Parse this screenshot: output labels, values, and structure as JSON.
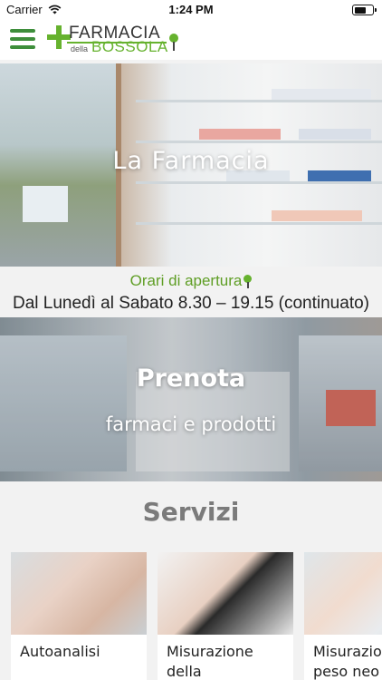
{
  "status_bar": {
    "carrier": "Carrier",
    "time": "1:24 PM",
    "battery_level": 0.7
  },
  "header": {
    "logo": {
      "line1": "FARMACIA",
      "della": "della",
      "line2": "BOSSOLA"
    },
    "menu_icon": "hamburger-menu-icon"
  },
  "hero": {
    "title": "La Farmacia",
    "slides_count": 2,
    "active_slide": 1
  },
  "hours": {
    "title": "Orari di apertura",
    "text": "Dal Lunedì al Sabato 8.30 – 19.15 (continuato)"
  },
  "prenota": {
    "title": "Prenota",
    "subtitle": "farmaci e prodotti"
  },
  "servizi": {
    "title": "Servizi",
    "cards": [
      {
        "label": "Autoanalisi"
      },
      {
        "label": "Misurazione della"
      },
      {
        "label": "Misurazione peso neo"
      }
    ]
  },
  "colors": {
    "brand_green": "#66b22e",
    "menu_green": "#3e8e3b",
    "hours_green": "#5f9e25"
  }
}
